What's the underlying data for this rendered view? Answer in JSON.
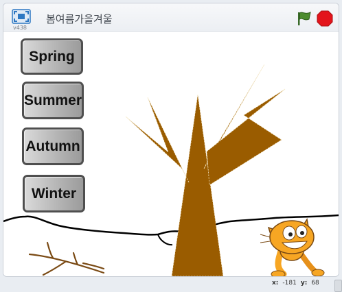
{
  "titlebar": {
    "version": "v438",
    "project_title": "봄여름가을겨울",
    "icons": {
      "fullscreen": "fullscreen-icon",
      "green_flag": "green-flag-icon",
      "stop": "stop-icon"
    }
  },
  "stage": {
    "buttons": [
      {
        "label": "Spring"
      },
      {
        "label": "Summer"
      },
      {
        "label": "Autumn"
      },
      {
        "label": "Winter"
      }
    ],
    "colors": {
      "tree": "#9a5c00",
      "ground_line": "#000000",
      "branch": "#7a4a14",
      "cat_body": "#f7a623",
      "button_border": "#4f4f4f"
    }
  },
  "statusbar": {
    "x_label": "x:",
    "x_value": "-181",
    "y_label": "y:",
    "y_value": "68"
  }
}
